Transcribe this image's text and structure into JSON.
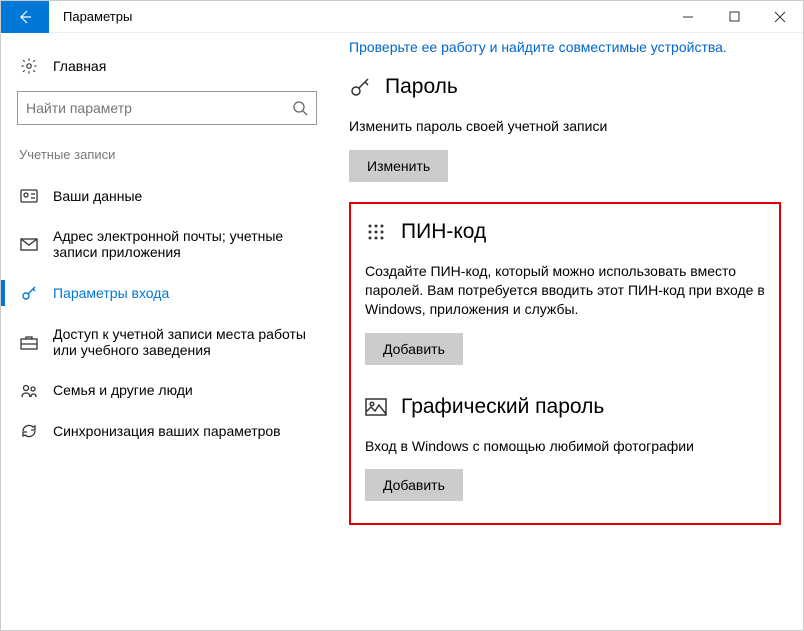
{
  "titlebar": {
    "title": "Параметры"
  },
  "sidebar": {
    "home_label": "Главная",
    "search_placeholder": "Найти параметр",
    "section_label": "Учетные записи",
    "items": [
      {
        "label": "Ваши данные"
      },
      {
        "label": "Адрес электронной почты; учетные записи приложения"
      },
      {
        "label": "Параметры входа"
      },
      {
        "label": "Доступ к учетной записи места работы или учебного заведения"
      },
      {
        "label": "Семья и другие люди"
      },
      {
        "label": "Синхронизация ваших параметров"
      }
    ]
  },
  "main": {
    "top_link": "Проверьте ее работу и найдите совместимые устройства.",
    "password": {
      "title": "Пароль",
      "desc": "Изменить пароль своей учетной записи",
      "button": "Изменить"
    },
    "pin": {
      "title": "ПИН-код",
      "desc": "Создайте ПИН-код, который можно использовать вместо паролей. Вам потребуется вводить этот ПИН-код при входе в Windows, приложения и службы.",
      "button": "Добавить"
    },
    "picture": {
      "title": "Графический пароль",
      "desc": "Вход в Windows с помощью любимой фотографии",
      "button": "Добавить"
    }
  }
}
